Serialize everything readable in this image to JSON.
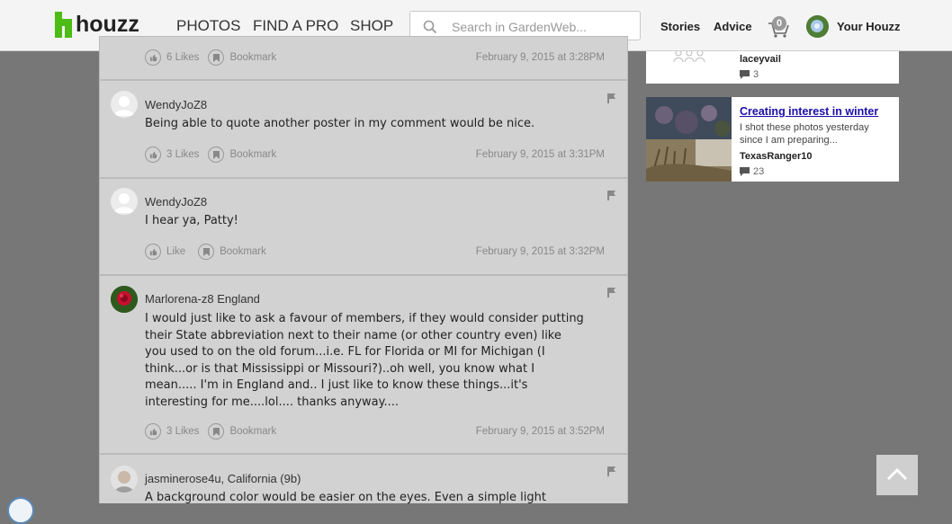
{
  "header": {
    "logo_text": "houzz",
    "nav": [
      "PHOTOS",
      "FIND A PRO",
      "SHOP"
    ],
    "search_placeholder": "Search in GardenWeb...",
    "stories": "Stories",
    "advice": "Advice",
    "cart_count": "0",
    "your_houzz": "Your Houzz"
  },
  "comments": [
    {
      "likes": "6 Likes",
      "bookmark": "Bookmark",
      "date": "February 9, 2015 at 3:28PM"
    },
    {
      "author": "WendyJoZ8",
      "body": "Being able to quote another poster in my comment would be nice.",
      "likes": "3 Likes",
      "bookmark": "Bookmark",
      "date": "February 9, 2015 at 3:31PM"
    },
    {
      "author": "WendyJoZ8",
      "body": "I hear ya, Patty!",
      "likes": "Like",
      "bookmark": "Bookmark",
      "date": "February 9, 2015 at 3:32PM"
    },
    {
      "author": "Marlorena-z8 England",
      "body": "I would just like to ask a favour of members, if they would consider putting their State abbreviation next to their name (or other country even) like you used to on the old forum...i.e. FL for Florida or MI for Michigan (I think...or is that Mississippi or Missouri?)..oh well, you know what I mean..... I'm in England and.. I just like to know these things...it's interesting for me....lol.... thanks anyway....",
      "likes": "3 Likes",
      "bookmark": "Bookmark",
      "date": "February 9, 2015 at 3:52PM"
    },
    {
      "author": "jasminerose4u, California (9b)",
      "body": "A background color would be easier on the eyes. Even a simple light"
    }
  ],
  "sidebar": [
    {
      "user": "laceyvail",
      "count": "3"
    },
    {
      "title": "Creating interest in winter",
      "desc": "I shot these photos yesterday since I am preparing...",
      "user": "TexasRanger10",
      "count": "23"
    }
  ],
  "colors": {
    "brand": "#4dbc15",
    "card_bg": "#d2d2d2",
    "page_bg": "#777777",
    "link": "#1a0dab"
  }
}
